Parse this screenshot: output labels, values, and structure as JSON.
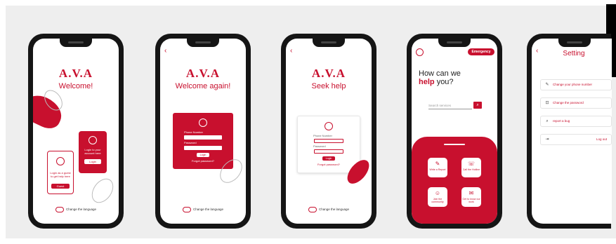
{
  "brand": {
    "accent": "#c8102e"
  },
  "common": {
    "change_language": "Change the language"
  },
  "screen1": {
    "logo": "A.V.A",
    "title": "Welcome!",
    "guest_text": "Login as a guest to get help here",
    "guest_button": "Guest",
    "user_text": "Login to your account here",
    "login_button": "Login"
  },
  "screen2": {
    "logo": "A.V.A",
    "title": "Welcome again!",
    "phone_label": "Phone Number",
    "password_label": "Password",
    "login_button": "Login",
    "forgot": "Forgot password?"
  },
  "screen3": {
    "logo": "A.V.A",
    "title": "Seek help",
    "phone_label": "Phone Number",
    "password_label": "Password",
    "login_button": "Login",
    "forgot": "Forgot password?"
  },
  "screen4": {
    "emergency": "Emergency",
    "headline_1": "How can we",
    "headline_bold": "help",
    "headline_2": "you?",
    "search_placeholder": "Search services",
    "services": [
      {
        "label": "Write a Report",
        "icon": "edit-icon"
      },
      {
        "label": "Call the Hotline",
        "icon": "phone-icon"
      },
      {
        "label": "Join the community",
        "icon": "community-icon"
      },
      {
        "label": "Get to know our work",
        "icon": "chat-icon"
      }
    ]
  },
  "screen5": {
    "title": "Setting",
    "rows": [
      {
        "label": "Change your phone number",
        "icon": "edit-icon"
      },
      {
        "label": "Change the password",
        "icon": "lock-icon"
      },
      {
        "label": "report a bug",
        "icon": "search-icon"
      },
      {
        "label": "Log out",
        "icon": "logout-icon"
      }
    ]
  }
}
